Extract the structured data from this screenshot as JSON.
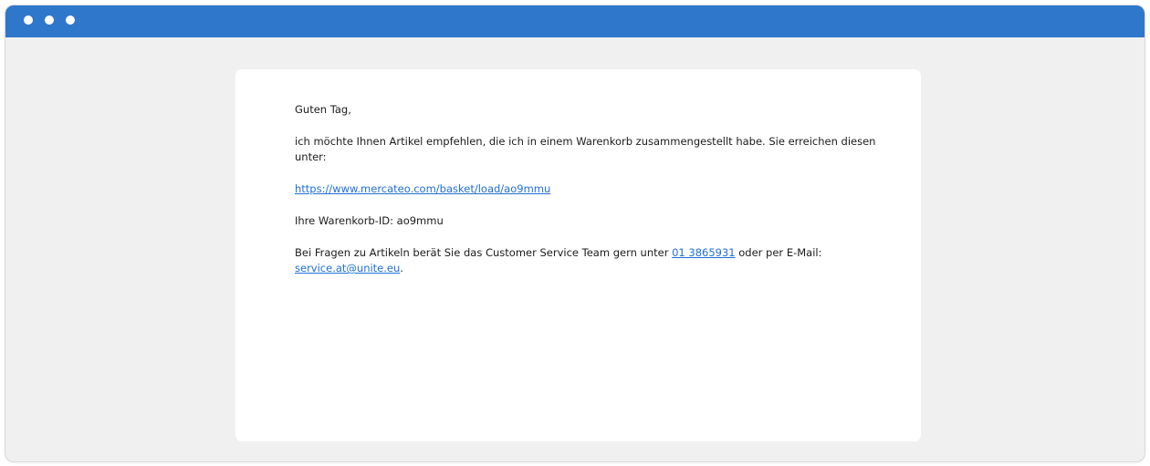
{
  "email": {
    "greeting": "Guten Tag,",
    "intro": "ich möchte Ihnen Artikel empfehlen, die ich in einem Warenkorb zusammengestellt habe. Sie erreichen diesen unter:",
    "basket_link": "https://www.mercateo.com/basket/load/ao9mmu",
    "basket_id_text": "Ihre Warenkorb-ID: ao9mmu",
    "contact_prefix": "Bei Fragen zu Artikeln berät Sie das Customer Service Team gern unter ",
    "phone_link": "01 3865931",
    "contact_middle": " oder per E-Mail: ",
    "email_link": "service.at@unite.eu",
    "contact_suffix": "."
  },
  "colors": {
    "titlebar": "#2f77cb",
    "window_background": "#f0f0f1",
    "link": "#1f6fd6"
  }
}
